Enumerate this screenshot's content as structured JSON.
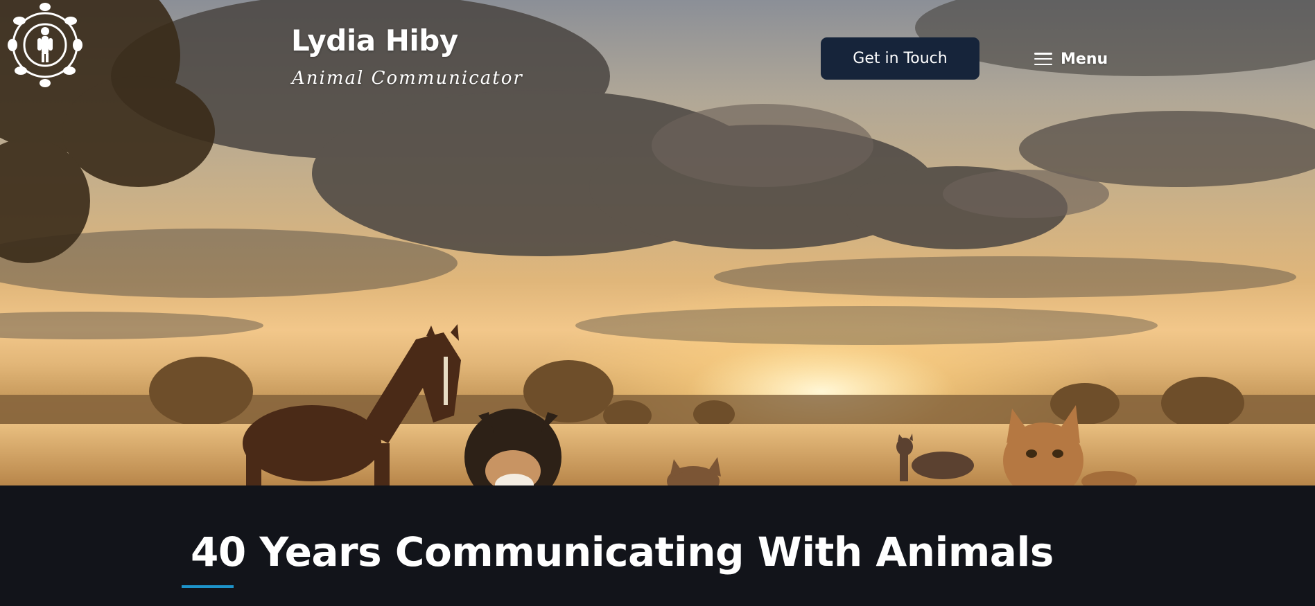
{
  "header": {
    "brand_name": "Lydia Hiby",
    "brand_tagline": "Animal Communicator",
    "cta_label": "Get in Touch",
    "menu_label": "Menu",
    "logo_icon": "animal-circle-logo-icon",
    "menu_icon": "hamburger-icon"
  },
  "hero": {
    "image_description_icon": "sunset-field-animals-image"
  },
  "intro": {
    "headline": "40 Years Communicating With Animals",
    "accent_color": "#1d93c9"
  },
  "colors": {
    "cta_background": "#16243a",
    "page_dark": "#12141a",
    "text": "#ffffff"
  }
}
